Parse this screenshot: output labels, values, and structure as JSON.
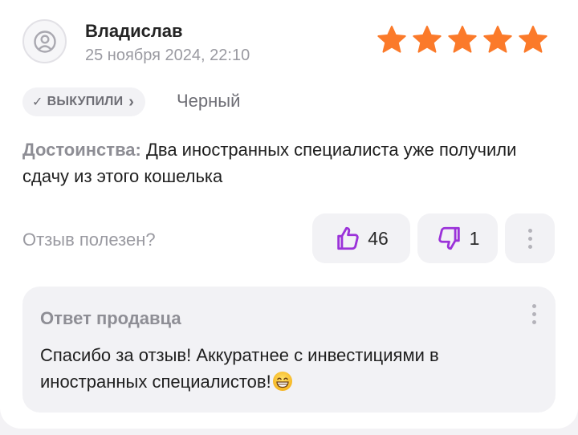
{
  "review": {
    "author": "Владислав",
    "date": "25 ноября 2024, 22:10",
    "rating": 5,
    "rating_color": "#fb7a2a",
    "badge_check": "✓",
    "badge_label": "ВЫКУПИЛИ",
    "badge_chevron": "›",
    "variant": "Черный",
    "pros_label": "Достоинства:",
    "pros_text": " Два иностранных специалиста уже получили сдачу из этого кошелька"
  },
  "helpful": {
    "label": "Отзыв полезен?",
    "likes": "46",
    "dislikes": "1",
    "accent_color": "#9b32d9"
  },
  "seller_reply": {
    "title": "Ответ продавца",
    "text": "Спасибо за отзыв! Аккуратнее с инвестициями в иностранных специалистов!",
    "emoji": "grinning-face-emoji"
  }
}
